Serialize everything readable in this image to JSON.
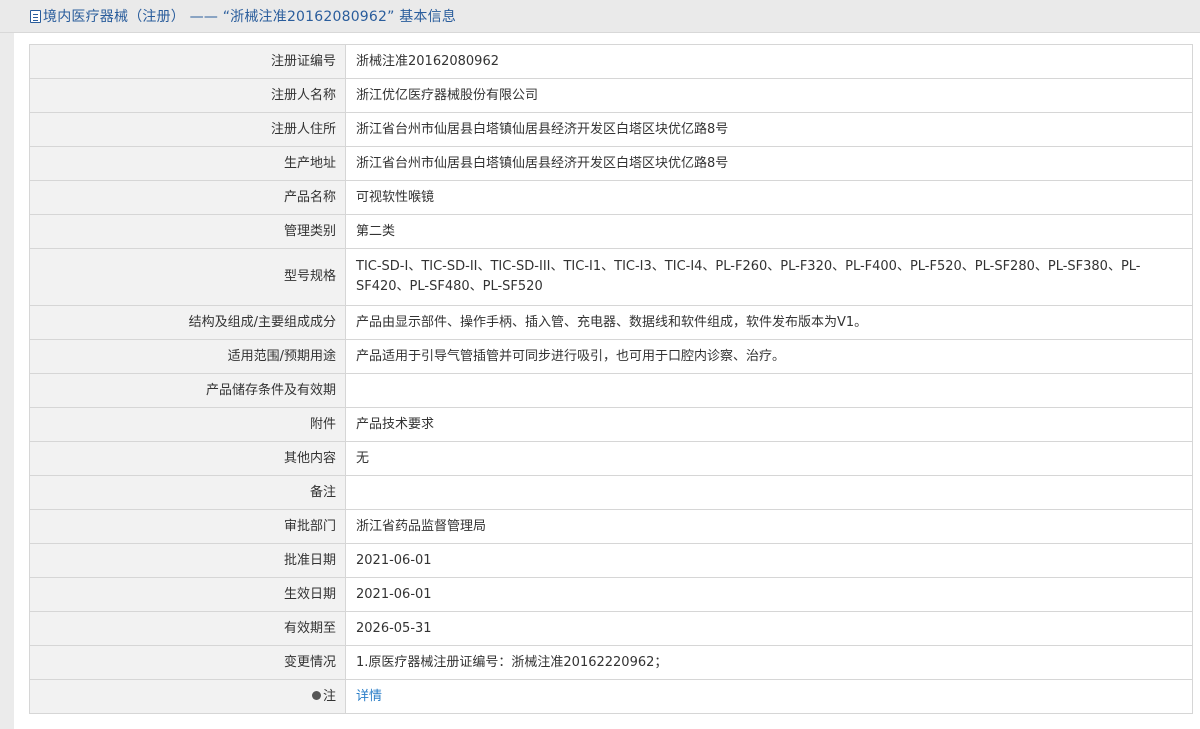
{
  "header": {
    "title": "境内医疗器械（注册） —— “浙械注准20162080962” 基本信息"
  },
  "rows": [
    {
      "label": "注册证编号",
      "value": "浙械注准20162080962"
    },
    {
      "label": "注册人名称",
      "value": "浙江优亿医疗器械股份有限公司"
    },
    {
      "label": "注册人住所",
      "value": "浙江省台州市仙居县白塔镇仙居县经济开发区白塔区块优亿路8号"
    },
    {
      "label": "生产地址",
      "value": "浙江省台州市仙居县白塔镇仙居县经济开发区白塔区块优亿路8号"
    },
    {
      "label": "产品名称",
      "value": "可视软性喉镜"
    },
    {
      "label": "管理类别",
      "value": "第二类"
    },
    {
      "label": "型号规格",
      "value": "TIC-SD-I、TIC-SD-II、TIC-SD-III、TIC-I1、TIC-I3、TIC-I4、PL-F260、PL-F320、PL-F400、PL-F520、PL-SF280、PL-SF380、PL-SF420、PL-SF480、PL-SF520"
    },
    {
      "label": "结构及组成/主要组成成分",
      "value": "产品由显示部件、操作手柄、插入管、充电器、数据线和软件组成，软件发布版本为V1。"
    },
    {
      "label": "适用范围/预期用途",
      "value": "产品适用于引导气管插管并可同步进行吸引，也可用于口腔内诊察、治疗。"
    },
    {
      "label": "产品储存条件及有效期",
      "value": ""
    },
    {
      "label": "附件",
      "value": "产品技术要求"
    },
    {
      "label": "其他内容",
      "value": "无"
    },
    {
      "label": "备注",
      "value": ""
    },
    {
      "label": "审批部门",
      "value": "浙江省药品监督管理局"
    },
    {
      "label": "批准日期",
      "value": "2021-06-01"
    },
    {
      "label": "生效日期",
      "value": "2021-06-01"
    },
    {
      "label": "有效期至",
      "value": "2026-05-31"
    },
    {
      "label": "变更情况",
      "value": "1.原医疗器械注册证编号：浙械注准20162220962；"
    }
  ],
  "note_row": {
    "label": "注",
    "link_text": "详情"
  },
  "icons": {
    "header": "document-icon",
    "note": "bulb-icon"
  },
  "colors": {
    "accent": "#2a5d9c",
    "link": "#2a7ec8",
    "label_bg": "#f2f2f2",
    "border": "#d6d6d6"
  }
}
